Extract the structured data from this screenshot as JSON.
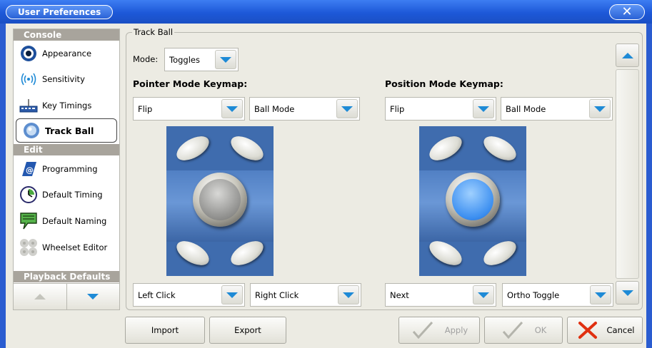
{
  "window": {
    "title": "User Preferences",
    "close_glyph": "✕"
  },
  "sidebar": {
    "sections": [
      {
        "label": "Console"
      },
      {
        "label": "Edit"
      },
      {
        "label": "Playback Defaults"
      }
    ],
    "items": [
      {
        "label": "Appearance",
        "icon": "eye-icon"
      },
      {
        "label": "Sensitivity",
        "icon": "signal-waves-icon"
      },
      {
        "label": "Key Timings",
        "icon": "keyboard-icon"
      },
      {
        "label": "Track Ball",
        "icon": "trackball-icon",
        "selected": true
      },
      {
        "label": "Programming",
        "icon": "programming-icon"
      },
      {
        "label": "Default Timing",
        "icon": "clock-icon"
      },
      {
        "label": "Default Naming",
        "icon": "speech-bubble-icon"
      },
      {
        "label": "Wheelset Editor",
        "icon": "wheelset-icon"
      }
    ]
  },
  "panel": {
    "group_title": "Track Ball",
    "mode_label": "Mode:",
    "mode_value": "Toggles",
    "pointer": {
      "title": "Pointer Mode Keymap:",
      "top_left": "Flip",
      "top_right": "Ball Mode",
      "bottom_left": "Left Click",
      "bottom_right": "Right Click",
      "ball_color": "#8a8a88"
    },
    "position": {
      "title": "Position Mode Keymap:",
      "top_left": "Flip",
      "top_right": "Ball Mode",
      "bottom_left": "Next",
      "bottom_right": "Ortho Toggle",
      "ball_color": "#3b8ef0"
    }
  },
  "footer": {
    "import_label": "Import",
    "export_label": "Export",
    "apply_label": "Apply",
    "ok_label": "OK",
    "cancel_label": "Cancel"
  },
  "colors": {
    "titlebar": "#2a5cd0",
    "section_header": "#a8a49c",
    "arrow_accent": "#1e8ad6",
    "cancel_x": "#e03010"
  }
}
